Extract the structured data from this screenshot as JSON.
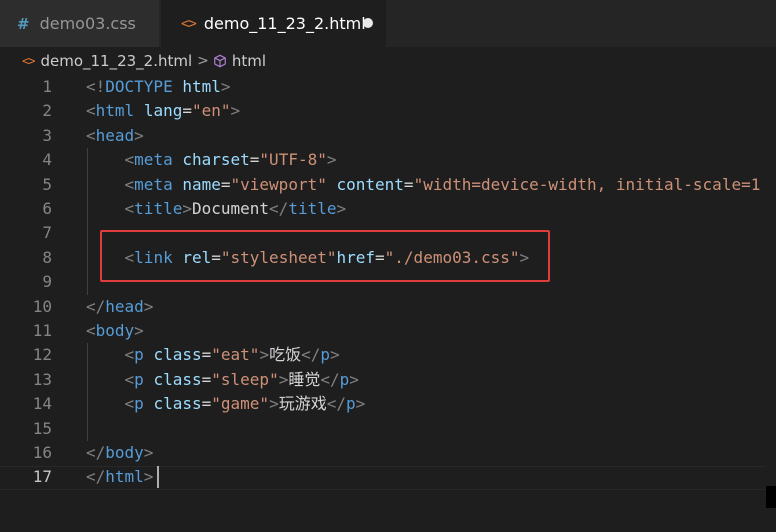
{
  "tabs": [
    {
      "icon": "#",
      "label": "demo03.css",
      "active": false
    },
    {
      "icon": "<>",
      "label": "demo_11_23_2.html",
      "active": true,
      "dirty": true
    }
  ],
  "breadcrumb": {
    "file_icon": "<>",
    "file": "demo_11_23_2.html",
    "separator": ">",
    "symbol": "html"
  },
  "editor": {
    "current_line": 17,
    "highlighted_line": 8,
    "lines": [
      {
        "num": "1",
        "tokens": [
          [
            "br",
            "<!"
          ],
          [
            "tag",
            "DOCTYPE"
          ],
          [
            "text",
            " "
          ],
          [
            "attr",
            "html"
          ],
          [
            "br",
            ">"
          ]
        ]
      },
      {
        "num": "2",
        "tokens": [
          [
            "br",
            "<"
          ],
          [
            "tag",
            "html"
          ],
          [
            "text",
            " "
          ],
          [
            "attr",
            "lang"
          ],
          [
            "eq",
            "="
          ],
          [
            "str",
            "\"en\""
          ],
          [
            "br",
            ">"
          ]
        ]
      },
      {
        "num": "3",
        "tokens": [
          [
            "br",
            "<"
          ],
          [
            "tag",
            "head"
          ],
          [
            "br",
            ">"
          ]
        ]
      },
      {
        "num": "4",
        "tokens": [
          [
            "text",
            "    "
          ],
          [
            "br",
            "<"
          ],
          [
            "tag",
            "meta"
          ],
          [
            "text",
            " "
          ],
          [
            "attr",
            "charset"
          ],
          [
            "eq",
            "="
          ],
          [
            "str",
            "\"UTF-8\""
          ],
          [
            "br",
            ">"
          ]
        ]
      },
      {
        "num": "5",
        "tokens": [
          [
            "text",
            "    "
          ],
          [
            "br",
            "<"
          ],
          [
            "tag",
            "meta"
          ],
          [
            "text",
            " "
          ],
          [
            "attr",
            "name"
          ],
          [
            "eq",
            "="
          ],
          [
            "str",
            "\"viewport\""
          ],
          [
            "text",
            " "
          ],
          [
            "attr",
            "content"
          ],
          [
            "eq",
            "="
          ],
          [
            "str",
            "\"width=device-width, initial-scale=1"
          ]
        ]
      },
      {
        "num": "6",
        "tokens": [
          [
            "text",
            "    "
          ],
          [
            "br",
            "<"
          ],
          [
            "tag",
            "title"
          ],
          [
            "br",
            ">"
          ],
          [
            "text",
            "Document"
          ],
          [
            "br",
            "</"
          ],
          [
            "tag",
            "title"
          ],
          [
            "br",
            ">"
          ]
        ]
      },
      {
        "num": "7",
        "tokens": []
      },
      {
        "num": "8",
        "tokens": [
          [
            "text",
            "    "
          ],
          [
            "br",
            "<"
          ],
          [
            "tag",
            "link"
          ],
          [
            "text",
            " "
          ],
          [
            "attr",
            "rel"
          ],
          [
            "eq",
            "="
          ],
          [
            "str",
            "\"stylesheet\""
          ],
          [
            "attr",
            "href"
          ],
          [
            "eq",
            "="
          ],
          [
            "str",
            "\"./demo03.css\""
          ],
          [
            "br",
            ">"
          ]
        ]
      },
      {
        "num": "9",
        "tokens": []
      },
      {
        "num": "10",
        "tokens": [
          [
            "br",
            "</"
          ],
          [
            "tag",
            "head"
          ],
          [
            "br",
            ">"
          ]
        ]
      },
      {
        "num": "11",
        "tokens": [
          [
            "br",
            "<"
          ],
          [
            "tag",
            "body"
          ],
          [
            "br",
            ">"
          ]
        ]
      },
      {
        "num": "12",
        "tokens": [
          [
            "text",
            "    "
          ],
          [
            "br",
            "<"
          ],
          [
            "tag",
            "p"
          ],
          [
            "text",
            " "
          ],
          [
            "attr",
            "class"
          ],
          [
            "eq",
            "="
          ],
          [
            "str",
            "\"eat\""
          ],
          [
            "br",
            ">"
          ],
          [
            "text",
            "吃饭"
          ],
          [
            "br",
            "</"
          ],
          [
            "tag",
            "p"
          ],
          [
            "br",
            ">"
          ]
        ]
      },
      {
        "num": "13",
        "tokens": [
          [
            "text",
            "    "
          ],
          [
            "br",
            "<"
          ],
          [
            "tag",
            "p"
          ],
          [
            "text",
            " "
          ],
          [
            "attr",
            "class"
          ],
          [
            "eq",
            "="
          ],
          [
            "str",
            "\"sleep\""
          ],
          [
            "br",
            ">"
          ],
          [
            "text",
            "睡觉"
          ],
          [
            "br",
            "</"
          ],
          [
            "tag",
            "p"
          ],
          [
            "br",
            ">"
          ]
        ]
      },
      {
        "num": "14",
        "tokens": [
          [
            "text",
            "    "
          ],
          [
            "br",
            "<"
          ],
          [
            "tag",
            "p"
          ],
          [
            "text",
            " "
          ],
          [
            "attr",
            "class"
          ],
          [
            "eq",
            "="
          ],
          [
            "str",
            "\"game\""
          ],
          [
            "br",
            ">"
          ],
          [
            "text",
            "玩游戏"
          ],
          [
            "br",
            "</"
          ],
          [
            "tag",
            "p"
          ],
          [
            "br",
            ">"
          ]
        ]
      },
      {
        "num": "15",
        "tokens": []
      },
      {
        "num": "16",
        "tokens": [
          [
            "br",
            "</"
          ],
          [
            "tag",
            "body"
          ],
          [
            "br",
            ">"
          ]
        ]
      },
      {
        "num": "17",
        "tokens": [
          [
            "br",
            "</"
          ],
          [
            "tag",
            "html"
          ],
          [
            "br",
            ">"
          ]
        ]
      }
    ]
  },
  "colors": {
    "background": "#1e1e1e",
    "tag": "#569cd6",
    "attribute": "#9cdcfe",
    "string": "#ce9178",
    "bracket": "#808080",
    "highlight_box": "#e03c3c"
  }
}
